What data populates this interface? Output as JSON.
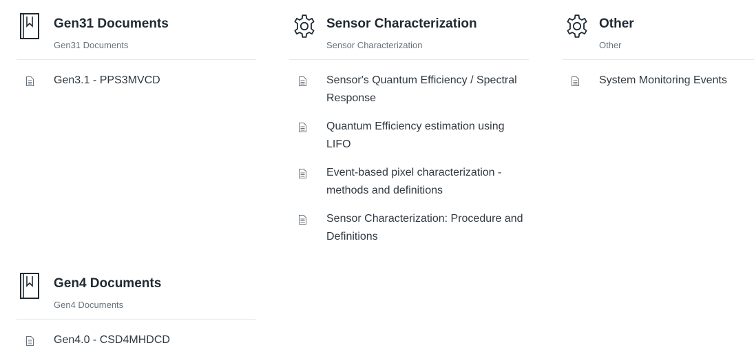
{
  "sections": [
    {
      "icon": "book-icon",
      "title": "Gen31 Documents",
      "subtitle": "Gen31 Documents",
      "articles": [
        {
          "title": "Gen3.1 - PPS3MVCD"
        }
      ]
    },
    {
      "icon": "gear-icon",
      "title": "Sensor Characterization",
      "subtitle": "Sensor Characterization",
      "articles": [
        {
          "title": "Sensor's Quantum Efficiency / Spectral Response"
        },
        {
          "title": "Quantum Efficiency estimation using LIFO"
        },
        {
          "title": "Event-based pixel characterization - methods and definitions"
        },
        {
          "title": "Sensor Characterization: Procedure and Definitions"
        }
      ]
    },
    {
      "icon": "gear-icon",
      "title": "Other",
      "subtitle": "Other",
      "articles": [
        {
          "title": "System Monitoring Events"
        }
      ]
    },
    {
      "icon": "book-icon",
      "title": "Gen4 Documents",
      "subtitle": "Gen4 Documents",
      "articles": [
        {
          "title": "Gen4.0 - CSD4MHDCD"
        }
      ]
    }
  ],
  "colors": {
    "title": "#1f2a33",
    "text": "#2f3942",
    "muted": "#68737d",
    "divider": "#e6e8ea"
  }
}
